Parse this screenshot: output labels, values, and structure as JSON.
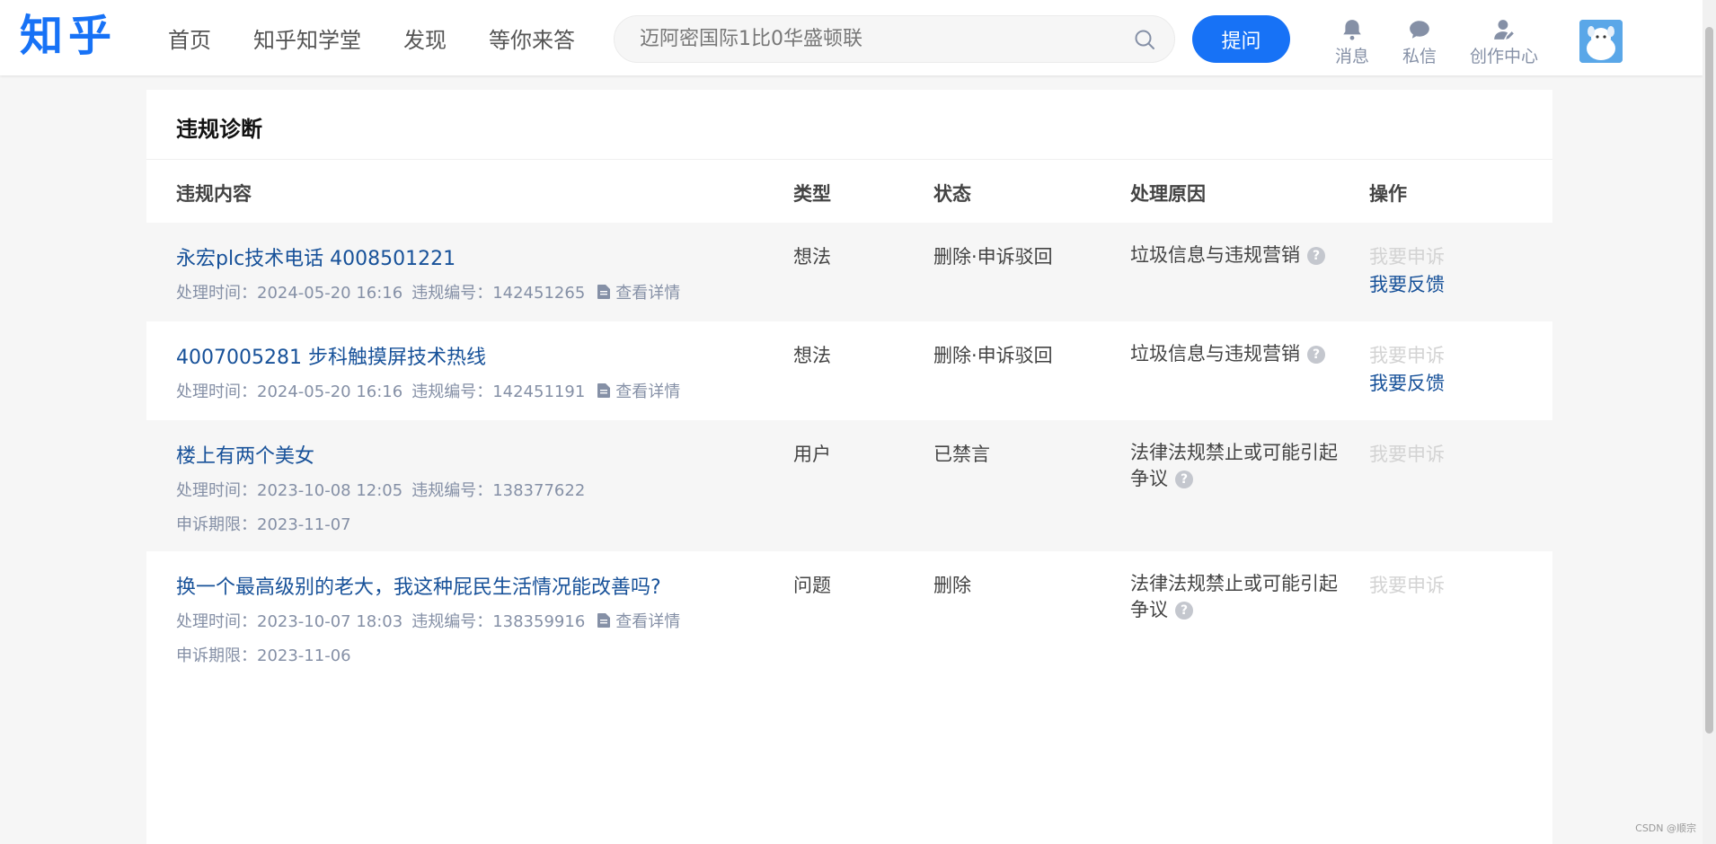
{
  "header": {
    "logo": "知乎",
    "nav": [
      "首页",
      "知乎知学堂",
      "发现",
      "等你来答"
    ],
    "search_placeholder": "迈阿密国际1比0华盛顿联",
    "ask_label": "提问",
    "icons": [
      {
        "label": "消息",
        "icon": "bell-icon"
      },
      {
        "label": "私信",
        "icon": "chat-bubble-icon"
      },
      {
        "label": "创作中心",
        "icon": "creator-person-icon"
      }
    ],
    "colors": {
      "brand": "#1772f6",
      "link": "#175199",
      "muted": "#8590a6"
    }
  },
  "card": {
    "title": "违规诊断",
    "columns": [
      "违规内容",
      "类型",
      "状态",
      "处理原因",
      "操作"
    ]
  },
  "rows": [
    {
      "title": "永宏plc技术电话 4008501221",
      "time_label": "处理时间：2024-05-20 16:16",
      "id_label": "违规编号：142451265",
      "detail": "查看详情",
      "type": "想法",
      "status": "删除·申诉驳回",
      "reason": "垃圾信息与违规营销",
      "appeal": "我要申诉",
      "feedback": "我要反馈"
    },
    {
      "title": "4007005281 步科触摸屏技术热线",
      "time_label": "处理时间：2024-05-20 16:16",
      "id_label": "违规编号：142451191",
      "detail": "查看详情",
      "type": "想法",
      "status": "删除·申诉驳回",
      "reason": "垃圾信息与违规营销",
      "appeal": "我要申诉",
      "feedback": "我要反馈"
    },
    {
      "title": "楼上有两个美女",
      "time_label": "处理时间：2023-10-08 12:05",
      "id_label": "违规编号：138377622",
      "deadline": "申诉期限：2023-11-07",
      "type": "用户",
      "status": "已禁言",
      "reason": "法律法规禁止或可能引起争议",
      "appeal": "我要申诉"
    },
    {
      "title": "换一个最高级别的老大，我这种屁民生活情况能改善吗?",
      "time_label": "处理时间：2023-10-07 18:03",
      "id_label": "违规编号：138359916",
      "detail": "查看详情",
      "deadline": "申诉期限：2023-11-06",
      "type": "问题",
      "status": "删除",
      "reason": "法律法规禁止或可能引起争议",
      "appeal": "我要申诉"
    }
  ],
  "footer": {
    "watermark": "CSDN @顺宗"
  }
}
